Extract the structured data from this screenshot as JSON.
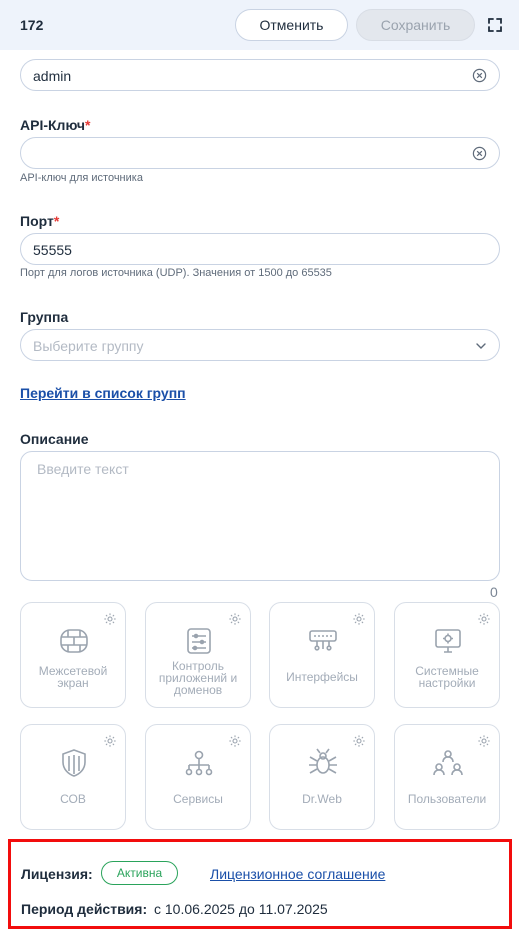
{
  "header": {
    "id": "172",
    "cancel_label": "Отменить",
    "save_label": "Сохранить"
  },
  "fields": {
    "login": {
      "value": "admin"
    },
    "api_key": {
      "label": "API-Ключ",
      "required_mark": "*",
      "value": "",
      "hint": "API-ключ для источника"
    },
    "port": {
      "label": "Порт",
      "required_mark": "*",
      "value": "55555",
      "hint": "Порт для логов источника (UDP). Значения от 1500 до 65535"
    },
    "group": {
      "label": "Группа",
      "placeholder": "Выберите группу"
    },
    "groups_link": "Перейти в список групп",
    "description": {
      "label": "Описание",
      "placeholder": "Введите текст",
      "counter": "0"
    }
  },
  "tiles": [
    {
      "label": "Межсетевой экран",
      "icon": "firewall-icon"
    },
    {
      "label": "Контроль приложений и доменов",
      "icon": "app-control-icon"
    },
    {
      "label": "Интерфейсы",
      "icon": "interfaces-icon"
    },
    {
      "label": "Системные настройки",
      "icon": "system-settings-icon"
    },
    {
      "label": "СОВ",
      "icon": "shield-icon"
    },
    {
      "label": "Сервисы",
      "icon": "services-icon"
    },
    {
      "label": "Dr.Web",
      "icon": "drweb-spider-icon"
    },
    {
      "label": "Пользователи",
      "icon": "users-icon"
    }
  ],
  "license": {
    "label": "Лицензия:",
    "status": "Активна",
    "agreement_link": "Лицензионное соглашение",
    "period_label": "Период действия:",
    "period_value": "с 10.06.2025 до 11.07.2025"
  },
  "colors": {
    "accent_link": "#1a4fa8",
    "status_active": "#2aa35b",
    "highlight_border": "#f20d0d",
    "header_bg": "#eef3fb"
  }
}
